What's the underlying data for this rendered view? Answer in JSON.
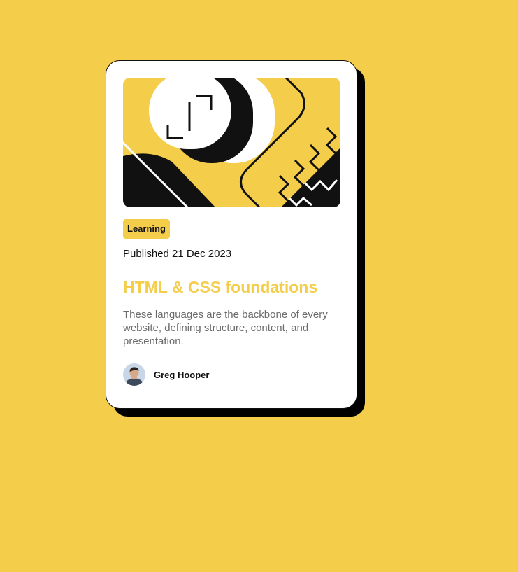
{
  "page": {
    "background_color": "#F4CE4B"
  },
  "card": {
    "hero_image": "abstract yellow black white illustration",
    "tag": "Learning",
    "published": "Published 21 Dec 2023",
    "title": "HTML & CSS foundations",
    "description": "These languages are the backbone of every website, defining structure, content, and presentation.",
    "author": {
      "name": "Greg Hooper",
      "avatar": "author-avatar-photo"
    },
    "accent_color": "#F4CE4B",
    "text_color": "#111111",
    "muted_text_color": "#6B6B6B"
  }
}
